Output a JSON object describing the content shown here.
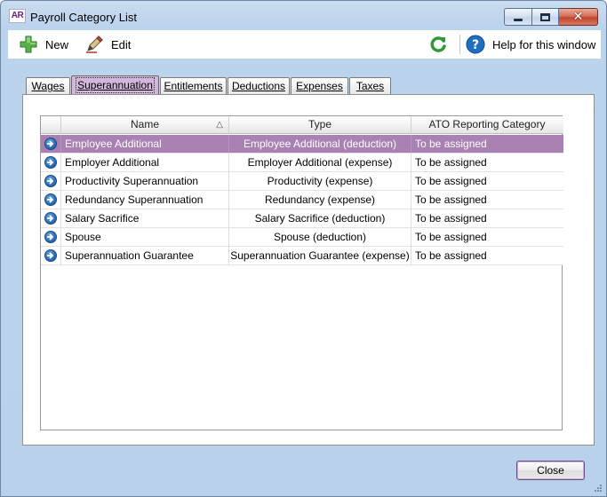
{
  "window": {
    "logo_text": "AR",
    "title": "Payroll Category List"
  },
  "toolbar": {
    "new_label": "New",
    "edit_label": "Edit",
    "help_label": "Help for this window"
  },
  "tabs": [
    {
      "label": "Wages",
      "active": false
    },
    {
      "label": "Superannuation",
      "active": true
    },
    {
      "label": "Entitlements",
      "active": false
    },
    {
      "label": "Deductions",
      "active": false
    },
    {
      "label": "Expenses",
      "active": false
    },
    {
      "label": "Taxes",
      "active": false
    }
  ],
  "table": {
    "columns": [
      "Name",
      "Type",
      "ATO Reporting Category"
    ],
    "sort_indicator": "△",
    "rows": [
      {
        "name": "Employee Additional",
        "type": "Employee Additional (deduction)",
        "ato": "To be assigned",
        "selected": true
      },
      {
        "name": "Employer Additional",
        "type": "Employer Additional (expense)",
        "ato": "To be assigned",
        "selected": false
      },
      {
        "name": "Productivity Superannuation",
        "type": "Productivity (expense)",
        "ato": "To be assigned",
        "selected": false
      },
      {
        "name": "Redundancy Superannuation",
        "type": "Redundancy (expense)",
        "ato": "To be assigned",
        "selected": false
      },
      {
        "name": "Salary Sacrifice",
        "type": "Salary Sacrifice (deduction)",
        "ato": "To be assigned",
        "selected": false
      },
      {
        "name": "Spouse",
        "type": "Spouse (deduction)",
        "ato": "To be assigned",
        "selected": false
      },
      {
        "name": "Superannuation Guarantee",
        "type": "Superannuation Guarantee (expense)",
        "ato": "To be assigned",
        "selected": false
      }
    ]
  },
  "footer": {
    "close_label": "Close"
  },
  "colors": {
    "accent_purple": "#a981b3",
    "active_tab": "#d2b6dc",
    "window_frame": "#bcd3ec",
    "refresh_green": "#2e9a3a",
    "help_blue": "#1f6fc0"
  }
}
